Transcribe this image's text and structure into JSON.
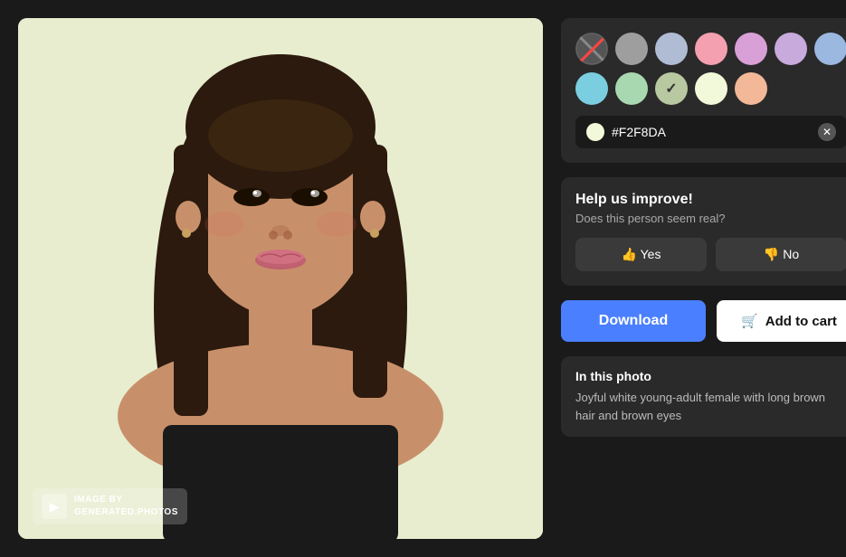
{
  "photo": {
    "watermark_line1": "IMAGE BY",
    "watermark_line2": "GENERATED.PHOTOS"
  },
  "colors": {
    "swatches": [
      {
        "id": "none",
        "color": "none",
        "label": "No color"
      },
      {
        "id": "gray",
        "color": "#9e9e9e",
        "label": "Gray"
      },
      {
        "id": "blue-gray",
        "color": "#b0bcd4",
        "label": "Blue Gray"
      },
      {
        "id": "pink",
        "color": "#f4a0b0",
        "label": "Pink"
      },
      {
        "id": "lavender",
        "color": "#d9a0d8",
        "label": "Lavender"
      },
      {
        "id": "light-purple",
        "color": "#c8aadd",
        "label": "Light Purple"
      },
      {
        "id": "light-blue",
        "color": "#9ab8e0",
        "label": "Light Blue"
      },
      {
        "id": "sky-blue",
        "color": "#7acee0",
        "label": "Sky Blue"
      },
      {
        "id": "mint",
        "color": "#a8d8b0",
        "label": "Mint"
      },
      {
        "id": "olive-selected",
        "color": "#b8c8a0",
        "label": "Olive",
        "selected": true
      },
      {
        "id": "cream",
        "color": "#F2F8DA",
        "label": "Cream"
      },
      {
        "id": "peach",
        "color": "#f2b898",
        "label": "Peach"
      }
    ],
    "hex_value": "#F2F8DA",
    "hex_placeholder": "#F2F8DA"
  },
  "feedback": {
    "title": "Help us improve!",
    "question": "Does this person seem real?",
    "yes_label": "👍 Yes",
    "no_label": "👎 No"
  },
  "actions": {
    "download_label": "Download",
    "cart_label": "Add to cart"
  },
  "description": {
    "section_label": "In this photo",
    "text": "Joyful white young-adult female with long brown hair and brown eyes"
  }
}
